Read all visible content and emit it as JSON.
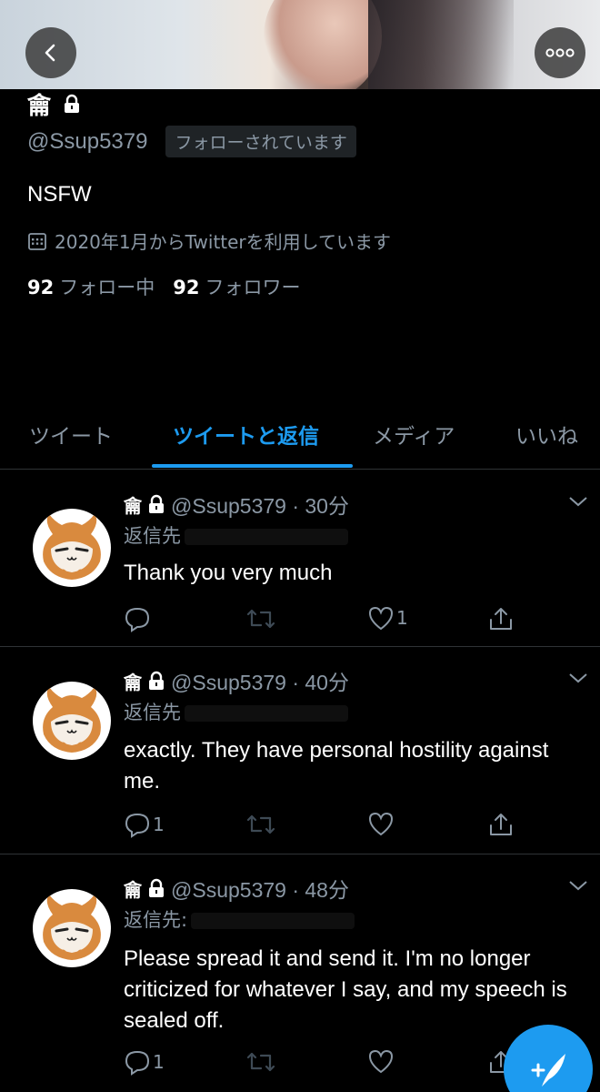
{
  "profile": {
    "name": "龠",
    "handle": "@Ssup5379",
    "follows_you_badge": "フォローされています",
    "bio": "NSFW",
    "joined": "2020年1月からTwitterを利用しています",
    "following_count": "92",
    "following_label": "フォロー中",
    "followers_count": "92",
    "followers_label": "フォロワー"
  },
  "tabs": [
    {
      "label": "ツイート",
      "active": false
    },
    {
      "label": "ツイートと返信",
      "active": true
    },
    {
      "label": "メディア",
      "active": false
    },
    {
      "label": "いいね",
      "active": false
    }
  ],
  "tweets": [
    {
      "name": "龠",
      "handle_time": "@Ssup5379 · 30分",
      "reply_prefix": "返信先",
      "text": "Thank you very much",
      "reply_count": "",
      "like_count": "1"
    },
    {
      "name": "龠",
      "handle_time": "@Ssup5379 · 40分",
      "reply_prefix": "返信先",
      "text": "exactly. They have personal hostility against me.",
      "reply_count": "1",
      "like_count": ""
    },
    {
      "name": "龠",
      "handle_time": "@Ssup5379 · 48分",
      "reply_prefix": "返信先:",
      "text": "Please spread it and send it. I'm no longer criticized for whatever I say, and my speech is sealed off.",
      "reply_count": "1",
      "like_count": ""
    }
  ],
  "colors": {
    "accent": "#1d9bf0",
    "secondary_text": "#8b98a5",
    "divider": "#2f3336",
    "background": "#000000"
  },
  "icons": [
    "back-arrow-icon",
    "more-icon",
    "lock-icon",
    "calendar-icon",
    "chevron-down-icon",
    "reply-icon",
    "retweet-icon",
    "like-icon",
    "share-icon",
    "compose-tweet-icon"
  ]
}
